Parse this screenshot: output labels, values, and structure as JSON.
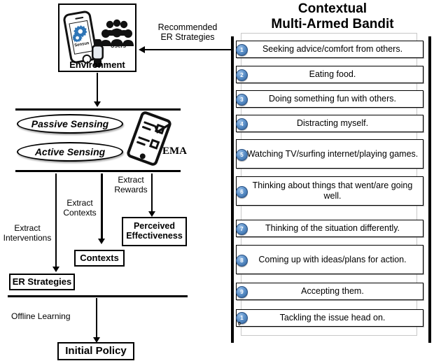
{
  "left_flow": {
    "environment": {
      "caption": "Environment",
      "phone_app_label": "Sensus",
      "users_label": "Users",
      "icons": [
        "phone-gear-icon",
        "users-group-icon",
        "wristband-icon"
      ]
    },
    "recommended_arrow": {
      "line1": "Recommended",
      "line2": "ER Strategies"
    },
    "sensing": {
      "passive": "Passive Sensing",
      "active": "Active Sensing",
      "ema_label": "EMA"
    },
    "extract_labels": {
      "interventions": {
        "line1": "Extract",
        "line2": "Interventions"
      },
      "contexts": {
        "line1": "Extract",
        "line2": "Contexts"
      },
      "rewards": {
        "line1": "Extract",
        "line2": "Rewards"
      }
    },
    "boxes": {
      "perceived_effectiveness_l1": "Perceived",
      "perceived_effectiveness_l2": "Effectiveness",
      "contexts": "Contexts",
      "er_strategies": "ER Strategies",
      "initial_policy": "Initial Policy"
    },
    "offline_learning": "Offline Learning"
  },
  "right_panel": {
    "title_line1": "Contextual",
    "title_line2": "Multi-Armed Bandit",
    "arms": [
      {
        "num": "1",
        "num_sub": "",
        "text": "Seeking advice/comfort from others."
      },
      {
        "num": "2",
        "num_sub": "",
        "text": "Eating food."
      },
      {
        "num": "3",
        "num_sub": "",
        "text": "Doing something fun with others."
      },
      {
        "num": "4",
        "num_sub": "",
        "text": "Distracting myself."
      },
      {
        "num": "5",
        "num_sub": "",
        "text": "Watching TV/surfing internet/playing games."
      },
      {
        "num": "6",
        "num_sub": "",
        "text": "Thinking about things that went/are going well."
      },
      {
        "num": "7",
        "num_sub": "",
        "text": "Thinking of the situation differently."
      },
      {
        "num": "8",
        "num_sub": "",
        "text": "Coming up with ideas/plans for action."
      },
      {
        "num": "9",
        "num_sub": "",
        "text": "Accepting them."
      },
      {
        "num": "1",
        "num_sub": "0",
        "text": "Tackling the issue head on."
      }
    ]
  },
  "colors": {
    "badge_blue": "#4a7ebb",
    "gear_blue": "#2e75b6",
    "ink": "#000000",
    "frame_gray": "#c8c8c8"
  }
}
